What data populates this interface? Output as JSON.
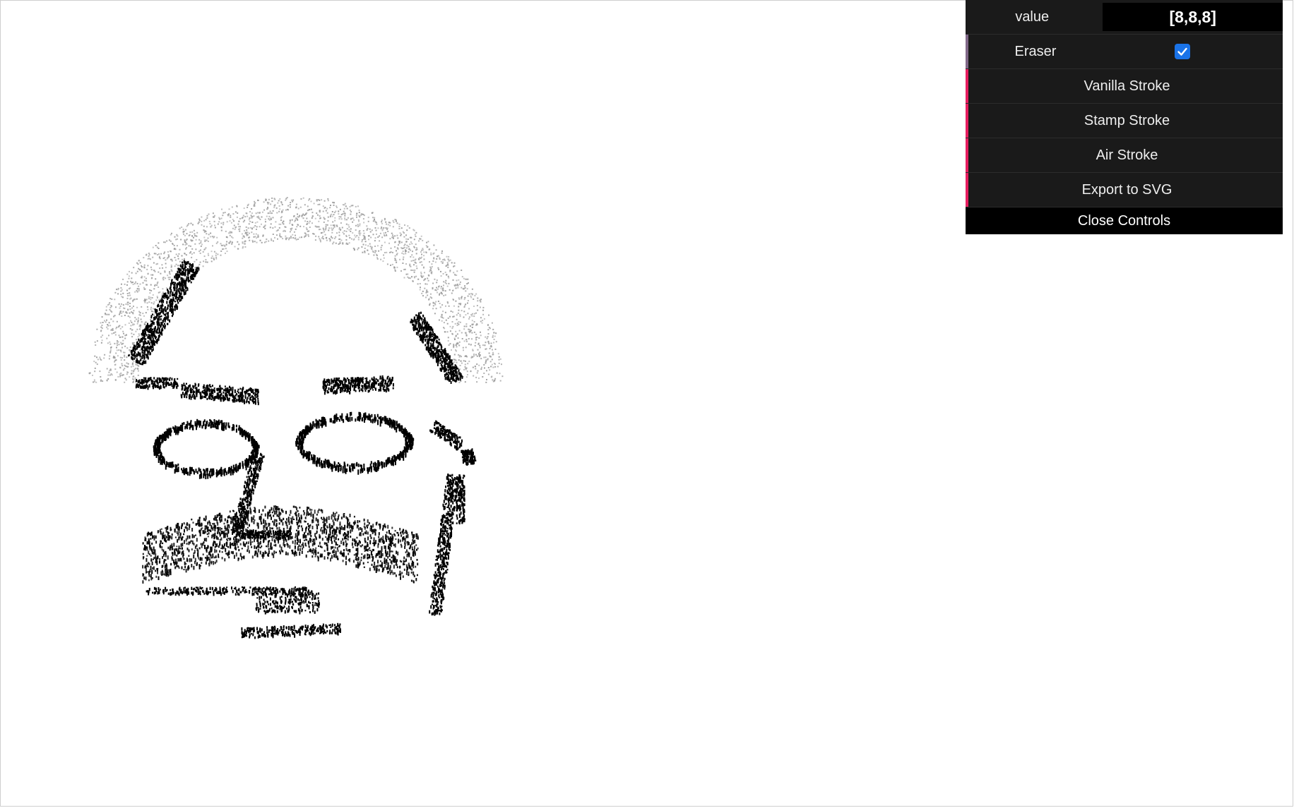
{
  "gui": {
    "value_label": "value",
    "value_text": "[8,8,8]",
    "eraser_label": "Eraser",
    "eraser_checked": true,
    "buttons": [
      "Vanilla Stroke",
      "Stamp Stroke",
      "Air Stroke",
      "Export to SVG"
    ],
    "close_label": "Close Controls"
  },
  "colors": {
    "panel_bg": "#1a1a1a",
    "func_accent": "#e61d5f",
    "bool_accent": "#806787",
    "checkbox_blue": "#1a73e8",
    "ink": "#000000",
    "air_ink": "#9a9a9a"
  },
  "canvas": {
    "subject": "stippled portrait drawing (bald head, glasses, moustache)"
  }
}
